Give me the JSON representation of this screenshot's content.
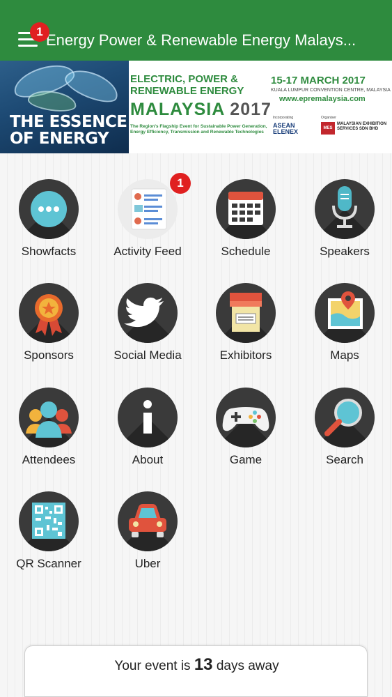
{
  "header": {
    "title": "Energy Power & Renewable Energy Malays...",
    "menu_badge": "1",
    "bg_color": "#2e8b3e"
  },
  "banner": {
    "left_text_line1": "THE ESSENCE",
    "left_text_line2": "OF ENERGY",
    "title_line1": "ELECTRIC, POWER &",
    "title_line2": "RENEWABLE ENERGY",
    "title_line3": "MALAYSIA",
    "year": "2017",
    "tagline": "The Region's Flagship Event for Sustainable Power Generation, Energy Efficiency, Transmission and Renewable Technologies",
    "dates": "15-17 MARCH 2017",
    "venue": "KUALA LUMPUR CONVENTION CENTRE, MALAYSIA",
    "url": "www.epremalaysia.com",
    "incorporating_label": "Incorporating",
    "incorporating_logo": "ASEAN ELENEX",
    "organiser_label": "Organiser",
    "organiser_abbr": "MES",
    "organiser_name": "MALAYSIAN EXHIBITION SERVICES SDN BHD"
  },
  "grid": [
    {
      "label": "Showfacts",
      "icon": "chat-bubble-icon"
    },
    {
      "label": "Activity Feed",
      "icon": "activity-feed-icon",
      "badge": "1"
    },
    {
      "label": "Schedule",
      "icon": "calendar-icon"
    },
    {
      "label": "Speakers",
      "icon": "microphone-icon"
    },
    {
      "label": "Sponsors",
      "icon": "award-ribbon-icon"
    },
    {
      "label": "Social Media",
      "icon": "twitter-bird-icon"
    },
    {
      "label": "Exhibitors",
      "icon": "booth-stall-icon"
    },
    {
      "label": "Maps",
      "icon": "map-pin-icon"
    },
    {
      "label": "Attendees",
      "icon": "people-group-icon"
    },
    {
      "label": "About",
      "icon": "info-icon"
    },
    {
      "label": "Game",
      "icon": "gamepad-icon"
    },
    {
      "label": "Search",
      "icon": "magnifier-icon"
    },
    {
      "label": "QR Scanner",
      "icon": "qr-code-icon"
    },
    {
      "label": "Uber",
      "icon": "car-icon"
    }
  ],
  "countdown": {
    "prefix": "Your event is",
    "days": "13",
    "suffix": "days away"
  }
}
